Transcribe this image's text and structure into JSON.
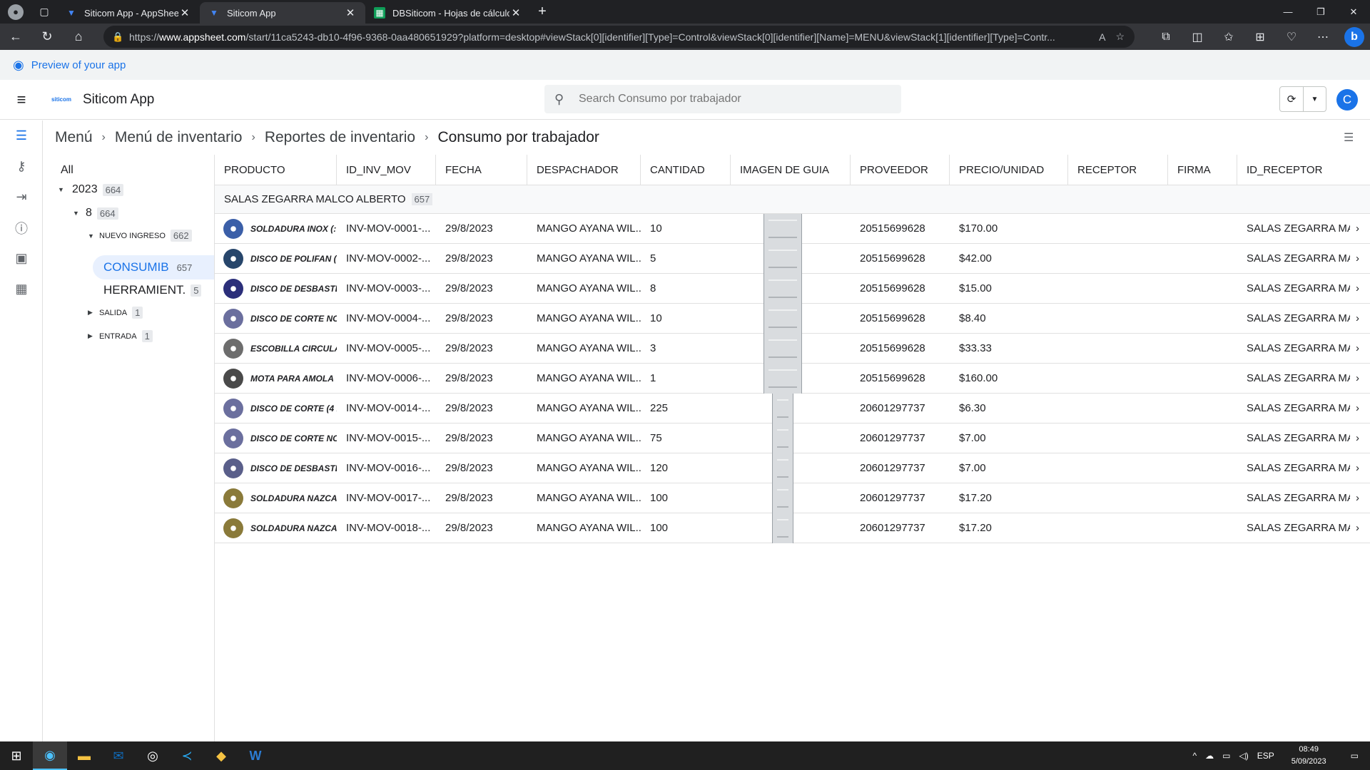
{
  "browser": {
    "tabs": [
      {
        "title": "Siticom App - AppSheet",
        "icon": "appsheet-icon"
      },
      {
        "title": "Siticom App",
        "icon": "appsheet-icon"
      },
      {
        "title": "DBSiticom - Hojas de cálculo de",
        "icon": "sheets-icon"
      }
    ],
    "url_prefix": "https://",
    "url_domain": "www.appsheet.com",
    "url_rest": "/start/11ca5243-db10-4f96-9368-0aa480651929?platform=desktop#viewStack[0][identifier][Type]=Control&viewStack[0][identifier][Name]=MENU&viewStack[1][identifier][Type]=Contr..."
  },
  "preview_label": "Preview of your app",
  "app": {
    "title": "Siticom App",
    "logo_text": "siticom",
    "search_placeholder": "Search Consumo por trabajador",
    "avatar_initial": "C"
  },
  "breadcrumb": [
    "Menú",
    "Menú de inventario",
    "Reportes de inventario",
    "Consumo por trabajador"
  ],
  "tree": {
    "all": "All",
    "year": {
      "label": "2023",
      "count": "664"
    },
    "month": {
      "label": "8",
      "count": "664"
    },
    "nuevo": {
      "label": "NUEVO INGRESO",
      "count": "662"
    },
    "consumib": {
      "label": "CONSUMIB",
      "count": "657"
    },
    "herramient": {
      "label": "HERRAMIENT.",
      "count": "5"
    },
    "salida": {
      "label": "SALIDA",
      "count": "1"
    },
    "entrada": {
      "label": "ENTRADA",
      "count": "1"
    }
  },
  "columns": [
    "PRODUCTO",
    "ID_INV_MOV",
    "FECHA",
    "DESPACHADOR",
    "CANTIDAD",
    "IMAGEN DE GUIA",
    "PROVEEDOR",
    "PRECIO/UNIDAD",
    "RECEPTOR",
    "FIRMA",
    "ID_RECEPTOR"
  ],
  "group": {
    "label": "SALAS ZEGARRA MALCO ALBERTO",
    "count": "657"
  },
  "rows": [
    {
      "producto": "SOLDADURA INOX (:",
      "id": "INV-MOV-0001-...",
      "fecha": "29/8/2023",
      "despachador": "MANGO AYANA WIL...",
      "cantidad": "10",
      "proveedor": "20515699628",
      "precio": "$170.00",
      "receptor": "",
      "firma": "",
      "id_receptor": "SALAS ZEGARRA MAI",
      "thumb": "#3b5fa8"
    },
    {
      "producto": "DISCO DE POLIFAN (",
      "id": "INV-MOV-0002-...",
      "fecha": "29/8/2023",
      "despachador": "MANGO AYANA WIL...",
      "cantidad": "5",
      "proveedor": "20515699628",
      "precio": "$42.00",
      "receptor": "",
      "firma": "",
      "id_receptor": "SALAS ZEGARRA MAI",
      "thumb": "#27466b"
    },
    {
      "producto": "DISCO DE DESBASTE",
      "id": "INV-MOV-0003-...",
      "fecha": "29/8/2023",
      "despachador": "MANGO AYANA WIL...",
      "cantidad": "8",
      "proveedor": "20515699628",
      "precio": "$15.00",
      "receptor": "",
      "firma": "",
      "id_receptor": "SALAS ZEGARRA MAI",
      "thumb": "#2b2f7a"
    },
    {
      "producto": "DISCO DE CORTE NO",
      "id": "INV-MOV-0004-...",
      "fecha": "29/8/2023",
      "despachador": "MANGO AYANA WIL...",
      "cantidad": "10",
      "proveedor": "20515699628",
      "precio": "$8.40",
      "receptor": "",
      "firma": "",
      "id_receptor": "SALAS ZEGARRA MAI",
      "thumb": "#6b6f9e"
    },
    {
      "producto": "ESCOBILLA CIRCULA",
      "id": "INV-MOV-0005-...",
      "fecha": "29/8/2023",
      "despachador": "MANGO AYANA WIL...",
      "cantidad": "3",
      "proveedor": "20515699628",
      "precio": "$33.33",
      "receptor": "",
      "firma": "",
      "id_receptor": "SALAS ZEGARRA MAI",
      "thumb": "#6d6d6d"
    },
    {
      "producto": "MOTA PARA AMOLA",
      "id": "INV-MOV-0006-...",
      "fecha": "29/8/2023",
      "despachador": "MANGO AYANA WIL...",
      "cantidad": "1",
      "proveedor": "20515699628",
      "precio": "$160.00",
      "receptor": "",
      "firma": "",
      "id_receptor": "SALAS ZEGARRA MAI",
      "thumb": "#4a4a4a"
    },
    {
      "producto": "DISCO DE CORTE (4 1",
      "id": "INV-MOV-0014-...",
      "fecha": "29/8/2023",
      "despachador": "MANGO AYANA WIL...",
      "cantidad": "225",
      "proveedor": "20601297737",
      "precio": "$6.30",
      "receptor": "",
      "firma": "",
      "id_receptor": "SALAS ZEGARRA MAI",
      "thumb": "#6b6f9e"
    },
    {
      "producto": "DISCO DE CORTE NO",
      "id": "INV-MOV-0015-...",
      "fecha": "29/8/2023",
      "despachador": "MANGO AYANA WIL...",
      "cantidad": "75",
      "proveedor": "20601297737",
      "precio": "$7.00",
      "receptor": "",
      "firma": "",
      "id_receptor": "SALAS ZEGARRA MAI",
      "thumb": "#6b6f9e"
    },
    {
      "producto": "DISCO DE DESBASTE",
      "id": "INV-MOV-0016-...",
      "fecha": "29/8/2023",
      "despachador": "MANGO AYANA WIL...",
      "cantidad": "120",
      "proveedor": "20601297737",
      "precio": "$7.00",
      "receptor": "",
      "firma": "",
      "id_receptor": "SALAS ZEGARRA MAI",
      "thumb": "#5a5f8a"
    },
    {
      "producto": "SOLDADURA NAZCA",
      "id": "INV-MOV-0017-...",
      "fecha": "29/8/2023",
      "despachador": "MANGO AYANA WIL...",
      "cantidad": "100",
      "proveedor": "20601297737",
      "precio": "$17.20",
      "receptor": "",
      "firma": "",
      "id_receptor": "SALAS ZEGARRA MAI",
      "thumb": "#8a7a3a"
    },
    {
      "producto": "SOLDADURA NAZCA",
      "id": "INV-MOV-0018-...",
      "fecha": "29/8/2023",
      "despachador": "MANGO AYANA WIL...",
      "cantidad": "100",
      "proveedor": "20601297737",
      "precio": "$17.20",
      "receptor": "",
      "firma": "",
      "id_receptor": "SALAS ZEGARRA MAI",
      "thumb": "#8a7a3a"
    }
  ],
  "taskbar": {
    "lang": "ESP",
    "time": "08:49",
    "date": "5/09/2023"
  },
  "colors": {
    "accent": "#1a73e8",
    "selected_bg": "#e8f0fe",
    "chrome_dark": "#202124"
  }
}
